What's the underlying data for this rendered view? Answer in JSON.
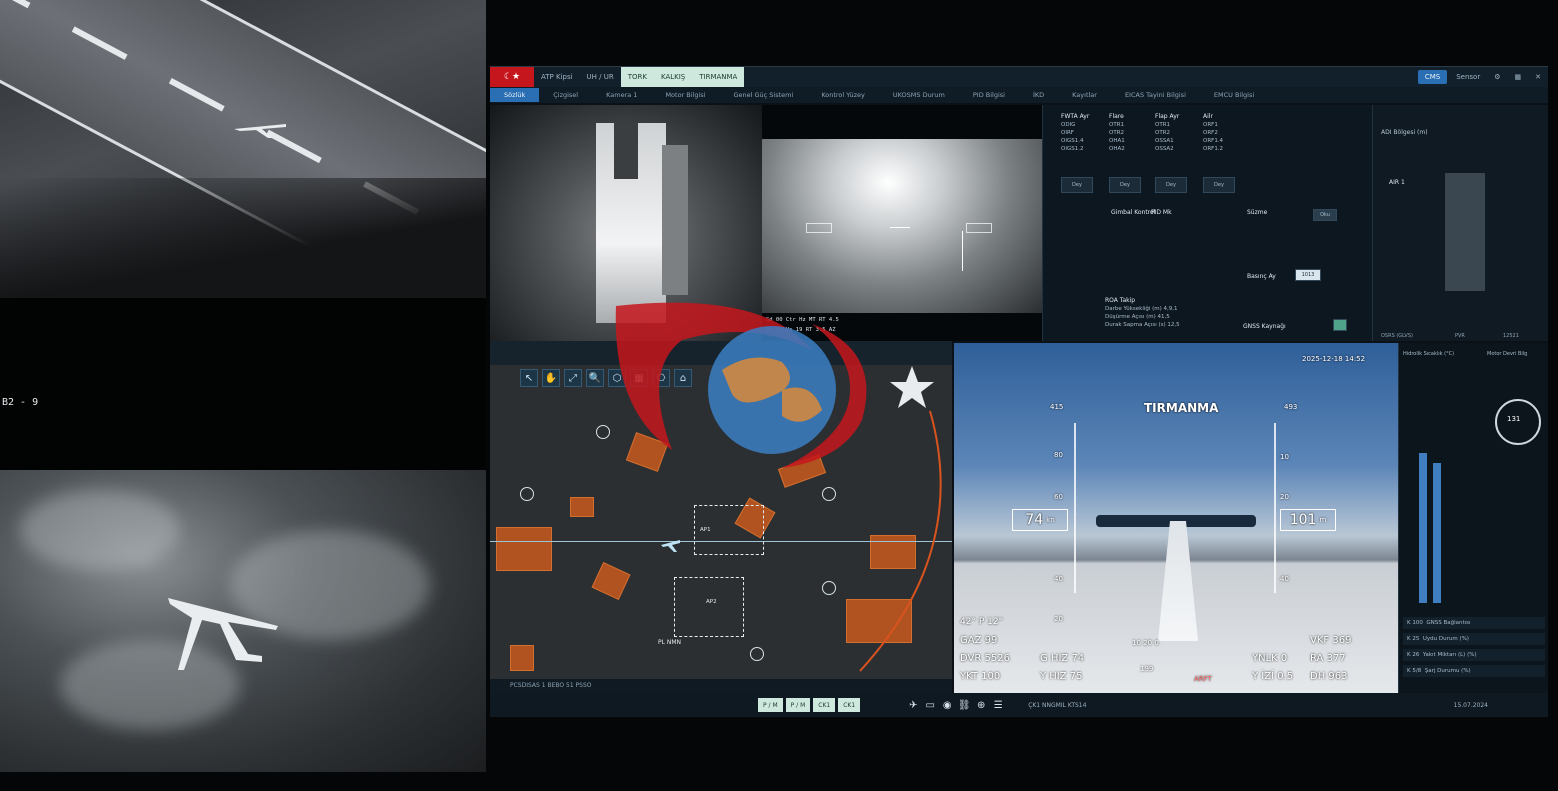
{
  "feeds": {
    "top_label": "",
    "callsign": "B2 - 9"
  },
  "gcs": {
    "flag_label": "C*",
    "topbar": [
      {
        "label": "ATP Kipsi",
        "style": "plain"
      },
      {
        "label": "UH / UR",
        "style": "plain"
      },
      {
        "label": "TORK",
        "style": "hl"
      },
      {
        "label": "KALKIŞ",
        "style": "hl"
      },
      {
        "label": "TIRMANMA",
        "style": "hl"
      },
      {
        "label": "CMS",
        "style": "blue"
      },
      {
        "label": "Sensor",
        "style": "plain"
      }
    ],
    "subbar": [
      {
        "label": "Sözlük",
        "active": true
      },
      {
        "label": "Çizgisel",
        "active": false
      },
      {
        "label": "Kamera 1",
        "active": false
      },
      {
        "label": "Motor Bilgisi",
        "active": false
      },
      {
        "label": "Genel Güç Sistemi",
        "active": false
      },
      {
        "label": "Kontrol Yüzey",
        "active": false
      },
      {
        "label": "UKOSMS Durum",
        "active": false
      },
      {
        "label": "PID Bilgisi",
        "active": false
      },
      {
        "label": "İKD",
        "active": false
      },
      {
        "label": "Kayıtlar",
        "active": false
      },
      {
        "label": "EICAS Tayini Bilgisi",
        "active": false
      },
      {
        "label": "EMCU Bilgisi",
        "active": false
      }
    ],
    "right_tabs": [
      "Durum",
      "i Lerk",
      "IO"
    ],
    "params": {
      "col1_title": "FWTA Ayr",
      "col2_title": "Flare",
      "col3_title": "Flap Ayr",
      "col4_title": "Ailr",
      "col1_rows": [
        "ODIG",
        "OIRF",
        "OIGS1.4",
        "OIGS1.2"
      ],
      "col2_rows": [
        "OTR1",
        "OTR2",
        "OHA1",
        "OHA2"
      ],
      "col3_rows": [
        "OTR1",
        "OTR2",
        "OSSA1",
        "OSSA2"
      ],
      "col4_rows": [
        "ORF1",
        "ORF2",
        "ORF1.4",
        "ORF1.2"
      ],
      "sub1_title": "Gimbal Kontrol",
      "sub2_title": "PID Mk",
      "sub3_title": "Süzme",
      "btn1": "Dey",
      "btn2": "Oku",
      "glide_title": "ROA Takip",
      "glide_rows": [
        "Darbe Yüksekliği (m)",
        "Düşürme Açısı (m)",
        "Durak Sapma Açısı (s)"
      ],
      "glide_values": [
        "4,9,1",
        "41,5",
        "12,5"
      ],
      "gnss_label": "GNSS Kaynağı",
      "basinc_label": "Basınç Ay",
      "basinc_btn": "1013"
    },
    "engine_panel": {
      "title": "ADI Bölgesi (m)",
      "row_label": "AIR 1",
      "bottom_left": "OSRS (GLVS)",
      "bottom_right": "PVR",
      "bottom_value": "12521"
    },
    "thermal": {
      "bottom_rows": [
        "Sd 00 Ctr Hz  MT  RT  4.5",
        "Bz 00  Vs  19  RT 3.5  AZ"
      ]
    },
    "map": {
      "status": "PCSDISAS  1  BEBO  51  PSSO",
      "route_label": "PL  NMN",
      "wp_labels": [
        "AP1",
        "AP2",
        "AP3"
      ],
      "tools": [
        "↖",
        "✋",
        "⤢",
        "🔍",
        "⬡",
        "▦",
        "⎔",
        "⌂"
      ]
    },
    "hud": {
      "mode": "TIRMANMA",
      "timestamp": "2025-12-18 14:52",
      "left_top": "415",
      "right_top": "493",
      "airspeed": "74",
      "airspeed_unit": "kn",
      "altitude": "101",
      "altitude_unit": "m",
      "pitch_readout": "42° P 12°",
      "gaz_label": "GAZ",
      "gaz_value": "99",
      "dvr_label": "DVR",
      "dvr_value": "5526",
      "ykt_label": "YKT",
      "ykt_value": "100",
      "ghiz_label": "G HIZ",
      "ghiz_value": "74",
      "yhiz_label": "Y HIZ",
      "yhiz_value": "75",
      "vkf_label": "VKF",
      "vkf_value": "369",
      "ra_label": "RA",
      "ra_value": "377",
      "dh_label": "DH",
      "dh_value": "963",
      "ynlk_label": "YNLK",
      "ynlk_value": "0",
      "yizi_label": "Y İZİ",
      "yizi_value": "0.5",
      "center_values": [
        "10",
        "20",
        "0"
      ],
      "center_bottom": "199",
      "center_alt": "ARFT",
      "ladder_left": [
        "80",
        "60",
        "40",
        "20"
      ],
      "ladder_right": [
        "10",
        "20",
        "40"
      ]
    },
    "right_inst": {
      "title_left": "Hidrolik Sıcaklık (°C)",
      "title_right": "Motor Devri Bilg",
      "dial_value": "131",
      "rows": [
        {
          "id": "K 100",
          "label": "GNSS Bağlantısı"
        },
        {
          "id": "K 25",
          "label": "Uydu Durum (%)"
        },
        {
          "id": "K 26",
          "label": "Yakıt Miktarı (L) (%)"
        },
        {
          "id": "K 5/8",
          "label": "Şarj Durumu (%)"
        }
      ],
      "bottom_date": "15.07.2024",
      "bottom_value": "1497"
    },
    "bottom_bar": {
      "buttons": [
        "P / M",
        "P / M",
        "CK1",
        "CK1"
      ],
      "right_text": "ÇK1  NNGMIL  KTS14"
    }
  },
  "colors": {
    "flag_red": "#c4161c",
    "accent_blue": "#2a6fb3",
    "mode_green": "#cfe8de",
    "zone_orange": "#c85a1e"
  }
}
